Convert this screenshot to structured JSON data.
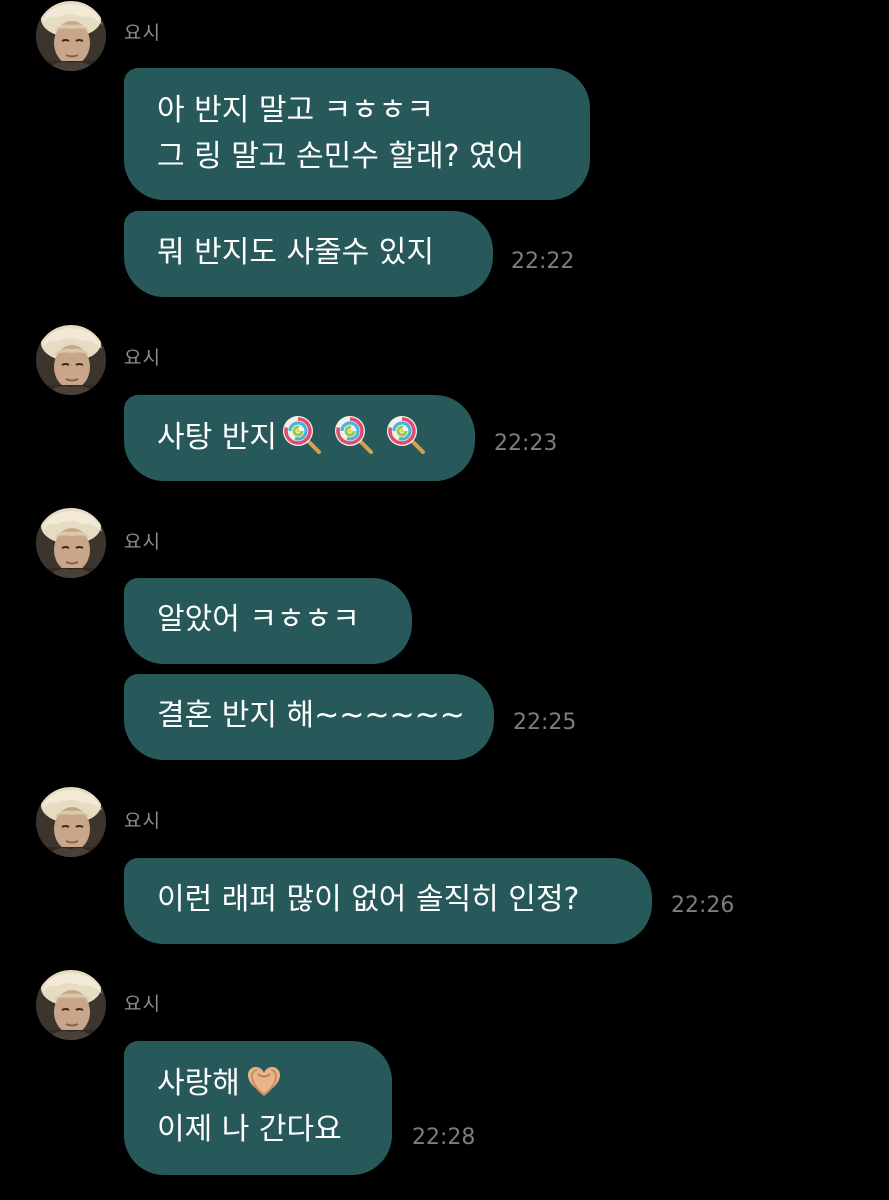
{
  "sender_name": "요시",
  "messages": [
    {
      "id": "g1b1",
      "lines": [
        "아 반지 말고 ㅋㅎㅎㅋ",
        "그 링 말고 손민수 할래? 였어"
      ]
    },
    {
      "id": "g1b2",
      "text": "뭐 반지도 사줄수 있지",
      "time": "22:22"
    },
    {
      "id": "g2b1",
      "text": "사탕 반지",
      "emoji": "lollipop-icon ×3",
      "time": "22:23"
    },
    {
      "id": "g3b1",
      "text": "알았어 ㅋㅎㅎㅋ"
    },
    {
      "id": "g3b2",
      "text": "결혼 반지 해~~~~~~",
      "time": "22:25"
    },
    {
      "id": "g4b1",
      "text": "이런 래퍼 많이 없어 솔직히 인정?",
      "time": "22:26"
    },
    {
      "id": "g5b1",
      "lines": [
        "사랑해",
        "이제 나 간다요"
      ],
      "emoji": "heart-hands-icon",
      "time": "22:28"
    }
  ],
  "colors": {
    "background": "#000000",
    "bubble": "#27595a",
    "bubble_text": "#ffffff",
    "timestamp": "#7d7d7d",
    "sender_name": "#8e8e8e"
  }
}
